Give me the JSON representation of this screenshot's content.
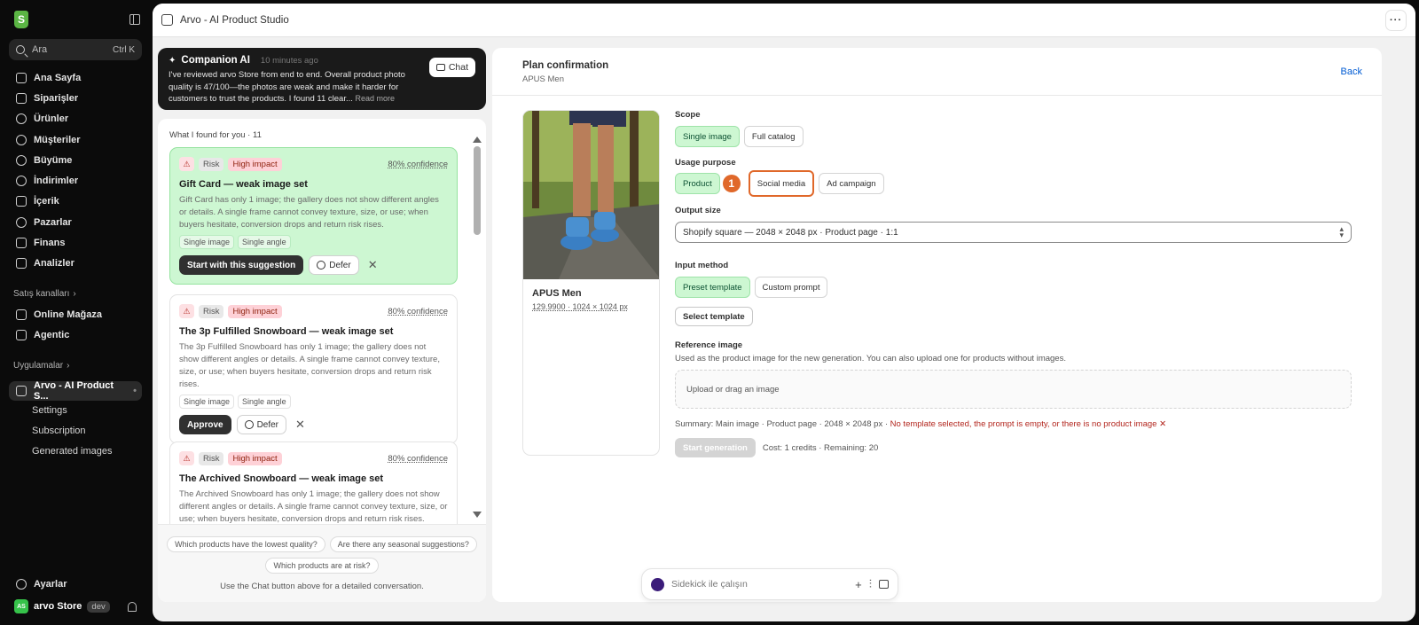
{
  "sidebar": {
    "search_placeholder": "Ara",
    "search_shortcut": "Ctrl K",
    "nav": [
      "Ana Sayfa",
      "Siparişler",
      "Ürünler",
      "Müşteriler",
      "Büyüme",
      "İndirimler",
      "İçerik",
      "Pazarlar",
      "Finans",
      "Analizler"
    ],
    "sales_channels_label": "Satış kanalları",
    "channels": [
      "Online Mağaza",
      "Agentic"
    ],
    "apps_label": "Uygulamalar",
    "app_name": "Arvo - AI Product S...",
    "app_sub": [
      "Settings",
      "Subscription",
      "Generated images"
    ],
    "settings_label": "Ayarlar",
    "store_initials": "AS",
    "store_name": "arvo Store",
    "store_badge": "dev"
  },
  "topbar": {
    "title": "Arvo - AI Product Studio",
    "more": "···"
  },
  "companion": {
    "title": "Companion AI",
    "time": "10 minutes ago",
    "text": "I've reviewed arvo Store from end to end. Overall product photo quality is 47/100—the photos are weak and make it harder for customers to trust the products. I found 11 clear...",
    "read_more": "Read more",
    "chat_label": "Chat"
  },
  "findings": {
    "header": "What I found for you · 11",
    "cards": [
      {
        "risk": "Risk",
        "impact": "High impact",
        "confidence": "80% confidence",
        "title": "Gift Card — weak image set",
        "body": "Gift Card has only 1 image; the gallery does not show different angles or details. A single frame cannot convey texture, size, or use; when buyers hesitate, conversion drops and return risk rises.",
        "chips": [
          "Single image",
          "Single angle"
        ],
        "primary": "Start with this suggestion",
        "defer": "Defer"
      },
      {
        "risk": "Risk",
        "impact": "High impact",
        "confidence": "80% confidence",
        "title": "The 3p Fulfilled Snowboard — weak image set",
        "body": "The 3p Fulfilled Snowboard has only 1 image; the gallery does not show different angles or details. A single frame cannot convey texture, size, or use; when buyers hesitate, conversion drops and return risk rises.",
        "chips": [
          "Single image",
          "Single angle"
        ],
        "primary": "Approve",
        "defer": "Defer"
      },
      {
        "risk": "Risk",
        "impact": "High impact",
        "confidence": "80% confidence",
        "title": "The Archived Snowboard — weak image set",
        "body": "The Archived Snowboard has only 1 image; the gallery does not show different angles or details. A single frame cannot convey texture, size, or use; when buyers hesitate, conversion drops and return risk rises."
      }
    ],
    "suggestions": [
      "Which products have the lowest quality?",
      "Are there any seasonal suggestions?",
      "Which products are at risk?"
    ],
    "footer": "Use the Chat button above for a detailed conversation."
  },
  "plan": {
    "title": "Plan confirmation",
    "subtitle": "APUS Men",
    "back": "Back",
    "product_name": "APUS Men",
    "product_meta": "129.9900 · 1024 × 1024 px",
    "scope_label": "Scope",
    "scope_options": [
      "Single image",
      "Full catalog"
    ],
    "purpose_label": "Usage purpose",
    "purpose_options": [
      "Product",
      "Social media",
      "Ad campaign"
    ],
    "step_marker": "1",
    "output_label": "Output size",
    "output_value": "Shopify square — 2048 × 2048 px · Product page · 1:1",
    "input_label": "Input method",
    "input_options": [
      "Preset template",
      "Custom prompt"
    ],
    "select_template": "Select template",
    "reference_label": "Reference image",
    "reference_help": "Used as the product image for the new generation. You can also upload one for products without images.",
    "upload_text": "Upload or drag an image",
    "summary_prefix": "Summary: Main image · Product page · 2048 × 2048 px · ",
    "summary_error": "No template selected, the prompt is empty, or there is no product image ✕",
    "generate": "Start generation",
    "cost": "Cost: 1 credits · Remaining: 20"
  },
  "sidekick": {
    "placeholder": "Sidekick ile çalışın"
  },
  "colors": {
    "accent_green": "#cdf7d2",
    "highlight_orange": "#e0682a",
    "error_red": "#b3261e",
    "link_blue": "#005bd3"
  }
}
